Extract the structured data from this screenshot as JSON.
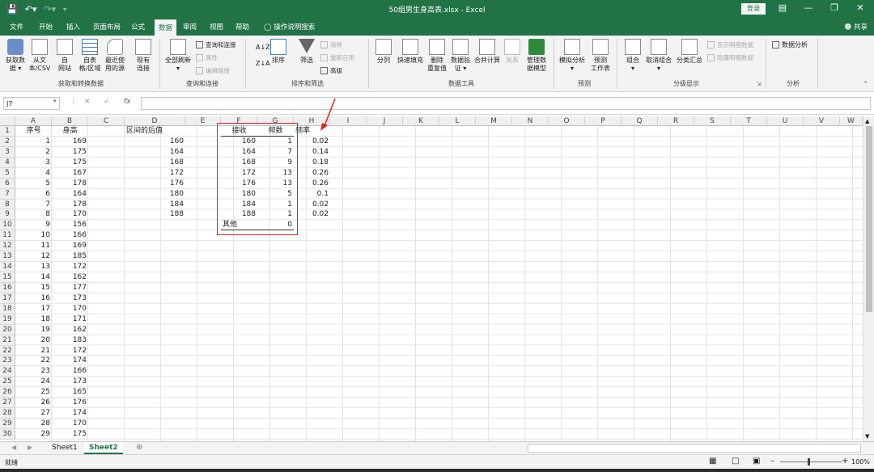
{
  "app": {
    "title": "50组男生身高表.xlsx - Excel",
    "login": "登录",
    "share": "共享"
  },
  "tabs": [
    "文件",
    "开始",
    "插入",
    "页面布局",
    "公式",
    "数据",
    "审阅",
    "视图",
    "帮助",
    "操作说明搜索"
  ],
  "active_tab": "数据",
  "ribbon": {
    "get_data": [
      "获取数",
      "据 ▾"
    ],
    "from_text": [
      "从文",
      "本/CSV"
    ],
    "from_web": [
      "自",
      "网站"
    ],
    "from_table": [
      "自表",
      "格/区域"
    ],
    "recent": [
      "最近使",
      "用的源"
    ],
    "existing": [
      "现有",
      "连接"
    ],
    "group1": "获取和转换数据",
    "refresh_all": [
      "全部刷新",
      "▾"
    ],
    "queries": "查询和连接",
    "properties": "属性",
    "edit_links": "编辑链接",
    "group2": "查询和连接",
    "sort": "排序",
    "filter": "筛选",
    "clear": "清除",
    "reapply": "重新应用",
    "advanced": "高级",
    "group3": "排序和筛选",
    "text_to_cols": "分列",
    "flash_fill": "快速填充",
    "remove_dup": [
      "删除",
      "重复值"
    ],
    "validation": [
      "数据验",
      "证 ▾"
    ],
    "consolidate": "合并计算",
    "relations": "关系",
    "data_model": [
      "管理数",
      "据模型"
    ],
    "group4": "数据工具",
    "what_if": [
      "模拟分析",
      "▾"
    ],
    "forecast": [
      "预测",
      "工作表"
    ],
    "group5": "预测",
    "group_btn": [
      "组合",
      "▾"
    ],
    "ungroup": [
      "取消组合",
      "▾"
    ],
    "subtotal": "分类汇总",
    "show_detail": "显示明细数据",
    "hide_detail": "隐藏明细数据",
    "group6": "分级显示",
    "data_analysis": "数据分析",
    "group7": "分析"
  },
  "formula_bar": {
    "name_box": "J7",
    "fx": "fx",
    "value": ""
  },
  "columns": [
    "A",
    "B",
    "C",
    "D",
    "E",
    "F",
    "G",
    "H",
    "I",
    "J",
    "K",
    "L",
    "M",
    "N",
    "O",
    "P",
    "Q",
    "R",
    "S",
    "T",
    "U",
    "V",
    "W"
  ],
  "rows": [
    "1",
    "2",
    "3",
    "4",
    "5",
    "6",
    "7",
    "8",
    "9",
    "10",
    "11",
    "12",
    "13",
    "14",
    "15",
    "16",
    "17",
    "18",
    "19",
    "20",
    "21",
    "22",
    "23",
    "24",
    "25",
    "26",
    "27",
    "28",
    "29",
    "30"
  ],
  "cells": {
    "headers": {
      "A": "序号",
      "B": "身高",
      "D": "区间的后值",
      "F": "接收",
      "G": "频数",
      "H": "频率"
    },
    "A": [
      "1",
      "2",
      "3",
      "4",
      "5",
      "6",
      "7",
      "8",
      "9",
      "10",
      "11",
      "12",
      "13",
      "14",
      "15",
      "16",
      "17",
      "18",
      "19",
      "20",
      "21",
      "22",
      "23",
      "24",
      "25",
      "26",
      "27",
      "28",
      "29"
    ],
    "B": [
      "169",
      "175",
      "175",
      "167",
      "178",
      "164",
      "178",
      "170",
      "156",
      "166",
      "169",
      "185",
      "172",
      "162",
      "177",
      "173",
      "170",
      "171",
      "162",
      "183",
      "172",
      "174",
      "166",
      "173",
      "165",
      "176",
      "174",
      "170",
      "175"
    ],
    "D": [
      "160",
      "164",
      "168",
      "172",
      "176",
      "180",
      "184",
      "188"
    ],
    "F": [
      "160",
      "164",
      "168",
      "172",
      "176",
      "180",
      "184",
      "188",
      "其他"
    ],
    "G": [
      "1",
      "7",
      "9",
      "13",
      "13",
      "5",
      "1",
      "1",
      "0"
    ],
    "H": [
      "0.02",
      "0.14",
      "0.18",
      "0.26",
      "0.26",
      "0.1",
      "0.02",
      "0.02"
    ]
  },
  "sheets": [
    "Sheet1",
    "Sheet2"
  ],
  "active_sheet": "Sheet2",
  "status": {
    "ready": "就绪",
    "zoom": "100%"
  },
  "colors": {
    "brand": "#217346",
    "highlight": "#e02020"
  }
}
